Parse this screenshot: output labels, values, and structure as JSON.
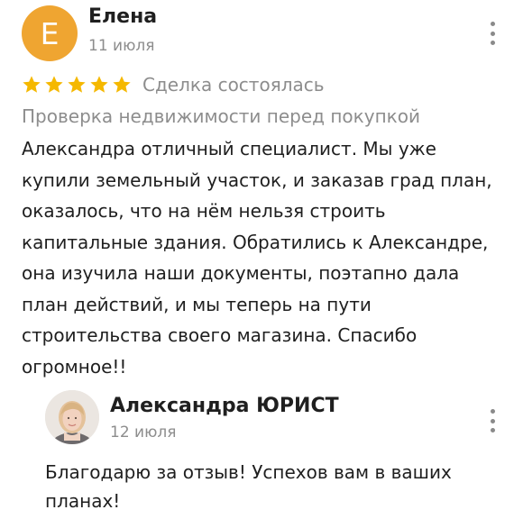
{
  "review": {
    "author": {
      "initial": "Е",
      "name": "Елена",
      "date": "11 июля",
      "avatar_color": "#efa531"
    },
    "rating": 5,
    "star_color": "#f5b800",
    "deal_status": "Сделка состоялась",
    "service": "Проверка недвижимости перед покупкой",
    "text": "Александра отличный специалист. Мы уже купили земельный участок, и заказав  град план, оказалось, что на нём нельзя строить капитальные здания. Обратились к Александре, она изучила наши документы, поэтапно дала план действий, и мы теперь на пути строительства своего магазина. Спасибо огромное!!",
    "menu_icon": "more-vertical-icon"
  },
  "reply": {
    "author": {
      "name": "Александра  ЮРИСТ",
      "date": "12 июля",
      "avatar_icon": "user-photo"
    },
    "text": "Благодарю за отзыв! Успехов вам в ваших планах!",
    "menu_icon": "more-vertical-icon"
  }
}
